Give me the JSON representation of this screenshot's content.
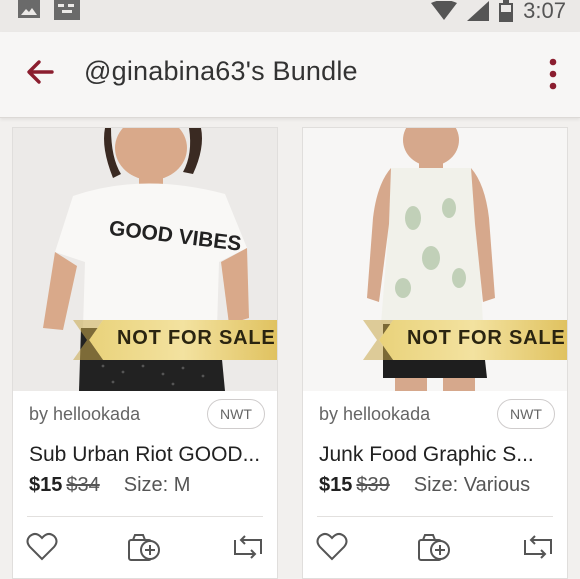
{
  "status_bar": {
    "time": "3:07",
    "left_icons": [
      "image-icon",
      "notification-icon"
    ],
    "right_icons": [
      "wifi-icon",
      "signal-icon",
      "battery-icon"
    ]
  },
  "header": {
    "title": "@ginabina63's Bundle",
    "back_icon": "arrow-left-icon",
    "menu_icon": "more-vertical-icon",
    "accent_color": "#8b1e2f"
  },
  "listings": [
    {
      "banner": "NOT FOR SALE",
      "seller": "by hellookada",
      "condition": "NWT",
      "title": "Sub Urban Riot GOOD...",
      "price": "$15",
      "original_price": "$34",
      "size": "Size: M",
      "shirt_print": "GOOD VIBES"
    },
    {
      "banner": "NOT FOR SALE",
      "seller": "by hellookada",
      "condition": "NWT",
      "title": "Junk Food Graphic S...",
      "price": "$15",
      "original_price": "$39",
      "size": "Size: Various"
    }
  ],
  "card_actions": [
    "heart-icon",
    "add-to-bundle-icon",
    "share-icon"
  ]
}
